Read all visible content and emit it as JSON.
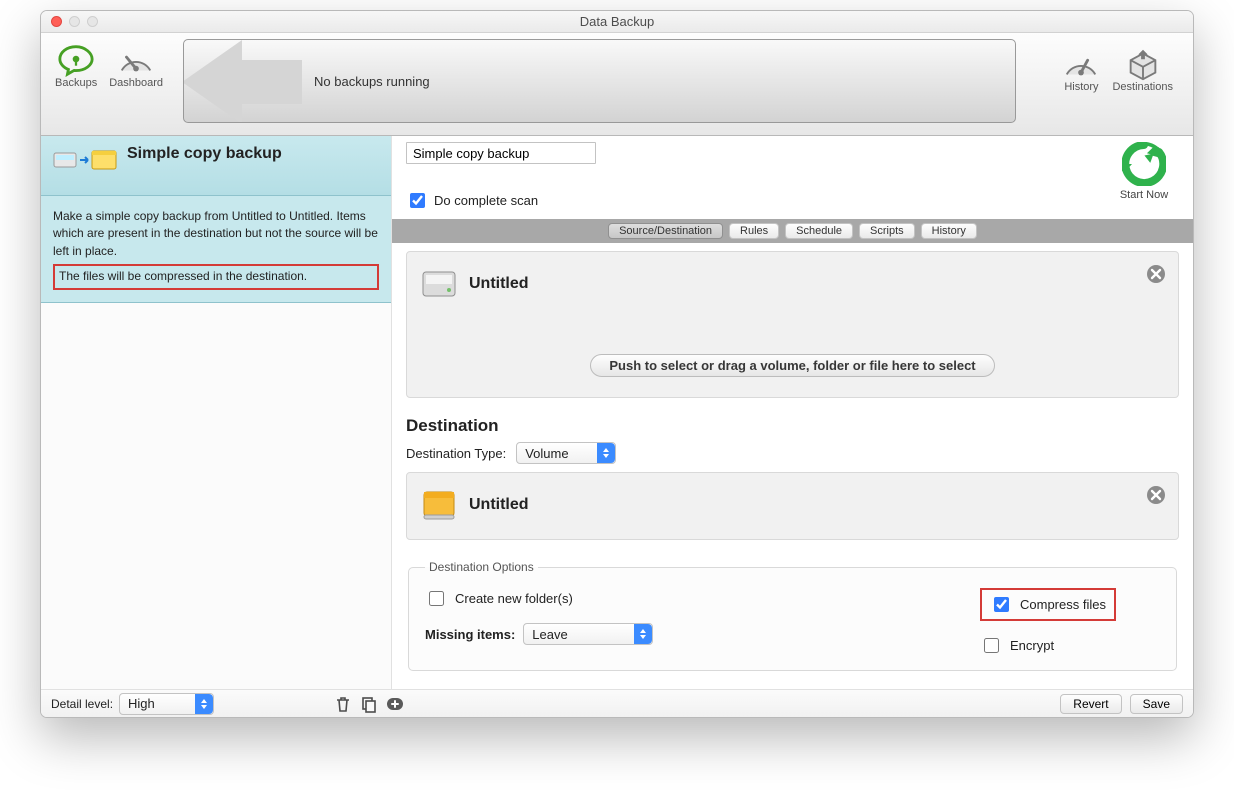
{
  "window_title": "Data Backup",
  "toolbar": {
    "backups_label": "Backups",
    "dashboard_label": "Dashboard",
    "history_label": "History",
    "destinations_label": "Destinations",
    "status_text": "No backups running"
  },
  "sidebar": {
    "set_title": "Simple copy backup",
    "desc_main": "Make a simple copy backup from Untitled to Untitled. Items which are present in the destination but not the source will be left in place.",
    "desc_highlight": "The files will be compressed in the destination."
  },
  "main": {
    "name_value": "Simple copy backup",
    "start_label": "Start Now",
    "complete_scan_label": "Do complete scan",
    "complete_scan_checked": true,
    "tabs": [
      "Source/Destination",
      "Rules",
      "Schedule",
      "Scripts",
      "History"
    ],
    "active_tab": 0,
    "source_name": "Untitled",
    "drag_hint": "Push to select or drag a volume, folder or file here to select",
    "dest_heading": "Destination",
    "dest_type_label": "Destination Type:",
    "dest_type_value": "Volume",
    "dest_name": "Untitled",
    "dest_options": {
      "legend": "Destination Options",
      "create_folders_label": "Create new folder(s)",
      "create_folders_checked": false,
      "missing_label": "Missing items:",
      "missing_value": "Leave",
      "compress_label": "Compress files",
      "compress_checked": true,
      "encrypt_label": "Encrypt",
      "encrypt_checked": false
    }
  },
  "footer": {
    "detail_label": "Detail level:",
    "detail_value": "High",
    "revert": "Revert",
    "save": "Save"
  }
}
